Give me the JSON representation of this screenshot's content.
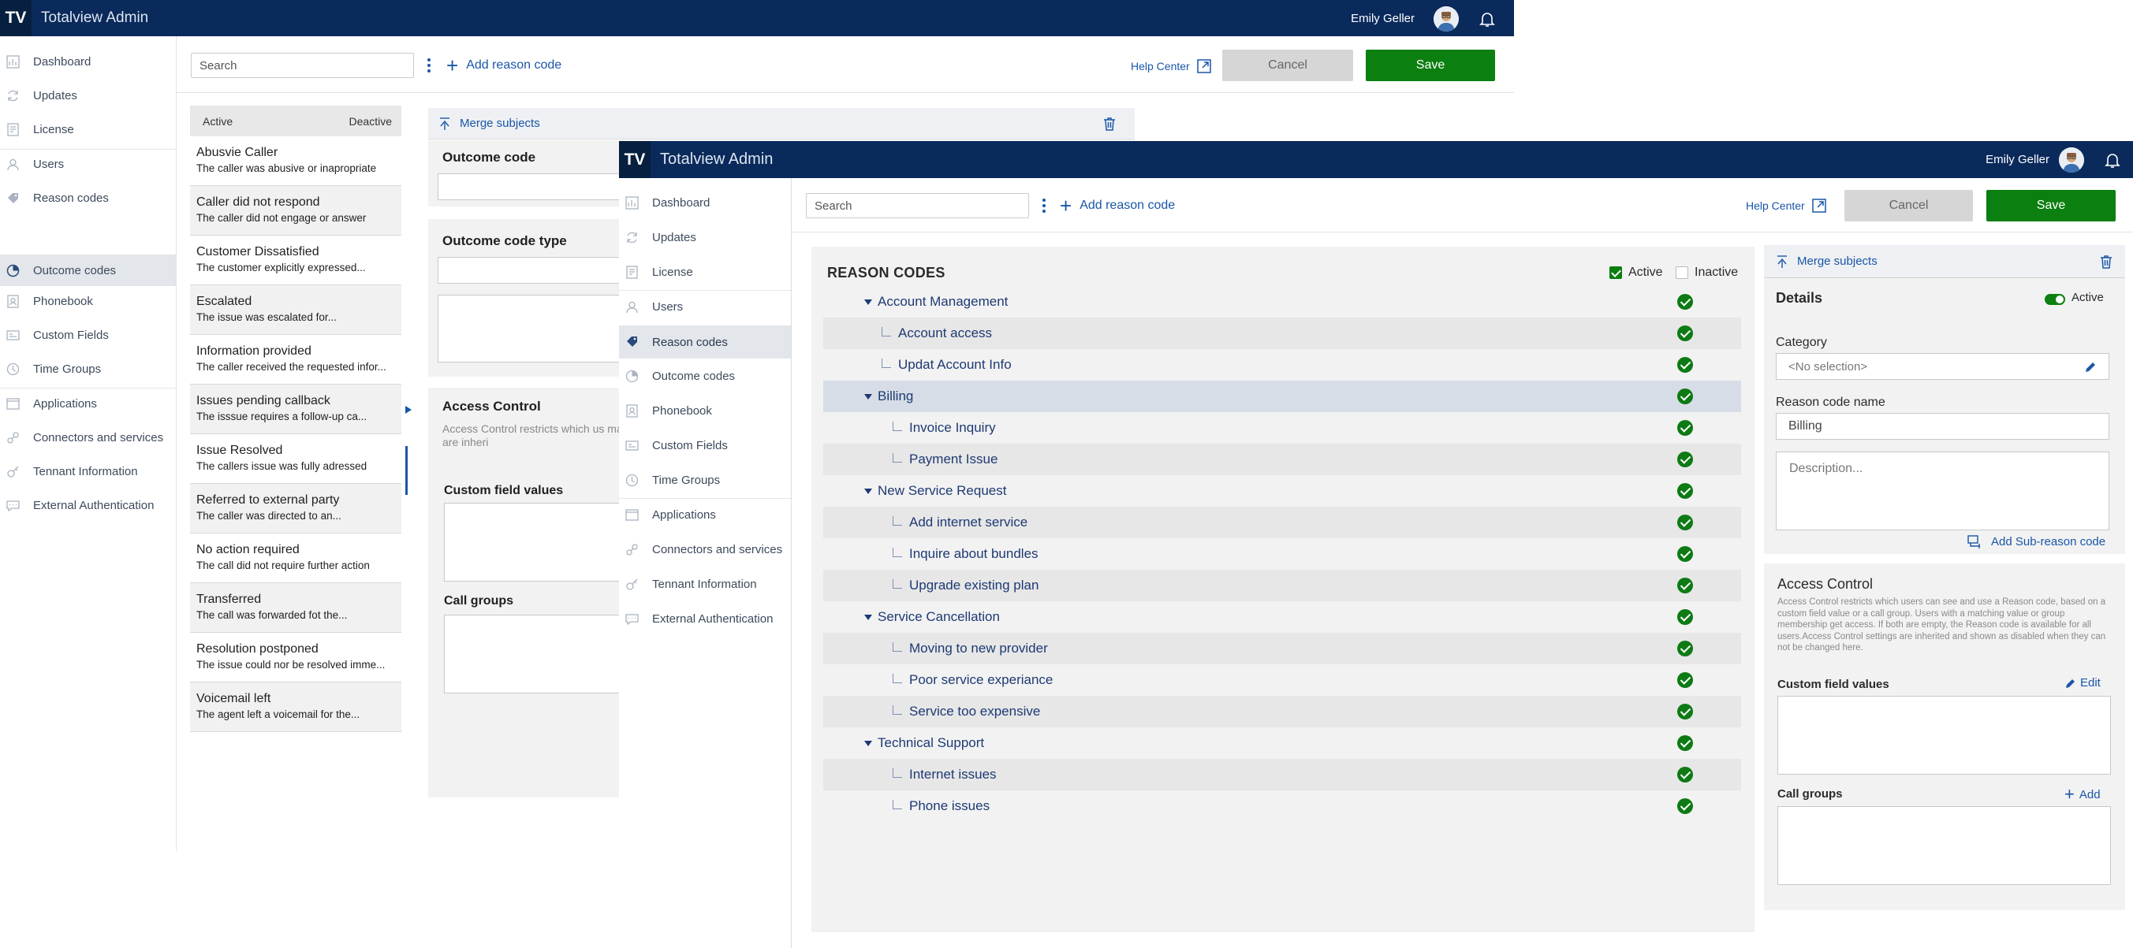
{
  "brand": {
    "logo": "TV",
    "app_title": "Totalview Admin"
  },
  "user": {
    "name": "Emily Geller"
  },
  "nav": [
    {
      "label": "Dashboard",
      "icon": "dashboard-icon"
    },
    {
      "label": "Updates",
      "icon": "updates-icon"
    },
    {
      "label": "License",
      "icon": "license-icon"
    },
    {
      "label": "Users",
      "icon": "users-icon"
    },
    {
      "label": "Reason codes",
      "icon": "reason-codes-icon"
    },
    {
      "label": "Outcome codes",
      "icon": "outcome-codes-icon"
    },
    {
      "label": "Phonebook",
      "icon": "phonebook-icon"
    },
    {
      "label": "Custom Fields",
      "icon": "custom-fields-icon"
    },
    {
      "label": "Time Groups",
      "icon": "time-groups-icon"
    },
    {
      "label": "Applications",
      "icon": "applications-icon"
    },
    {
      "label": "Connectors and services",
      "icon": "connectors-icon"
    },
    {
      "label": "Tennant Information",
      "icon": "tenant-info-icon"
    },
    {
      "label": "External Authentication",
      "icon": "external-auth-icon"
    }
  ],
  "toolbar": {
    "search_placeholder": "Search",
    "add_reason_code": "Add reason code",
    "help": "Help Center",
    "cancel": "Cancel",
    "save": "Save"
  },
  "w1": {
    "list_header": {
      "active": "Active",
      "deactive": "Deactive"
    },
    "items": [
      {
        "title": "Abusvie Caller",
        "desc": "The caller was abusive or inapropriate"
      },
      {
        "title": "Caller did not respond",
        "desc": "The caller did not engage or answer"
      },
      {
        "title": "Customer Dissatisfied",
        "desc": "The customer explicitly expressed..."
      },
      {
        "title": "Escalated",
        "desc": "The issue was escalated for..."
      },
      {
        "title": "Information provided",
        "desc": "The caller received the requested infor..."
      },
      {
        "title": "Issues pending callback",
        "desc": "The isssue requires a follow-up ca..."
      },
      {
        "title": "Issue Resolved",
        "desc": "The callers issue was fully adressed"
      },
      {
        "title": "Referred to external party",
        "desc": "The caller was directed to an..."
      },
      {
        "title": "No action required",
        "desc": "The call did not require further action"
      },
      {
        "title": "Transferred",
        "desc": "The call was forwarded fot the..."
      },
      {
        "title": "Resolution postponed",
        "desc": "The issue could nor be resolved imme..."
      },
      {
        "title": "Voicemail left",
        "desc": "The agent left a voicemail for the..."
      }
    ],
    "merge": "Merge subjects",
    "outcome_code": "Outcome code",
    "outcome_code_type": "Outcome code type",
    "access_control": "Access Control",
    "ac_desc": "Access Control restricts which us matching value or group members Access Control settings are inheri",
    "custom_field_values": "Custom field values",
    "call_groups": "Call groups"
  },
  "reason_codes": {
    "heading": "REASON CODES",
    "filter_active": "Active",
    "filter_inactive": "Inactive",
    "rows": [
      {
        "label": "Account Management",
        "level": 0
      },
      {
        "label": "Account access",
        "level": 1
      },
      {
        "label": "Updat Account Info",
        "level": 1
      },
      {
        "label": "Billing",
        "level": 0
      },
      {
        "label": "Invoice Inquiry",
        "level": 2
      },
      {
        "label": "Payment Issue",
        "level": 2
      },
      {
        "label": "New Service Request",
        "level": 0
      },
      {
        "label": "Add internet service",
        "level": 2
      },
      {
        "label": "Inquire about bundles",
        "level": 2
      },
      {
        "label": "Upgrade existing plan",
        "level": 2
      },
      {
        "label": "Service Cancellation",
        "level": 0
      },
      {
        "label": "Moving to new provider",
        "level": 2
      },
      {
        "label": "Poor service experiance",
        "level": 2
      },
      {
        "label": "Service too expensive",
        "level": 2
      },
      {
        "label": "Technical Support",
        "level": 0
      },
      {
        "label": "Internet issues",
        "level": 2
      },
      {
        "label": "Phone issues",
        "level": 2
      }
    ]
  },
  "details": {
    "merge": "Merge subjects",
    "title": "Details",
    "active": "Active",
    "category_label": "Category",
    "category_value": "<No selection>",
    "name_label": "Reason code name",
    "name_value": "Billing",
    "description_placeholder": "Description...",
    "add_sub": "Add Sub-reason code",
    "access_control": "Access Control",
    "ac_desc": "Access Control restricts which users can see and use a Reason code, based on a custom field value or a call group. Users with a matching value or group membership get access. If both are empty, the Reason code is available for all users.Access Control settings are inherited and shown as disabled when they can not be changed here.",
    "custom_field_values": "Custom field values",
    "edit": "Edit",
    "call_groups": "Call groups",
    "add": "Add"
  },
  "colors": {
    "topbar": "#0a2a5c",
    "save": "#0b7f0f",
    "link": "#1a56a8"
  }
}
